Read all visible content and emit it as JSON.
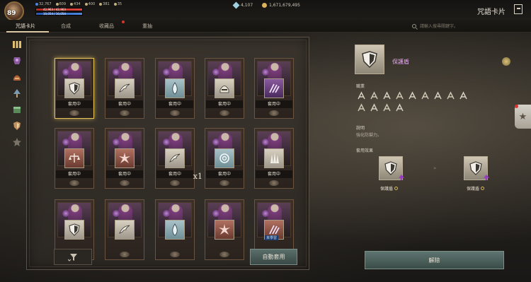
{
  "player": {
    "level": "89",
    "stats": [
      "32,767",
      "609",
      "434",
      "400",
      "381",
      "35"
    ],
    "hp_text": "42,963 / 42,963",
    "mp_text": "10,054 / 10,054"
  },
  "currency": {
    "gems": "4,107",
    "gold": "1,671,679,495"
  },
  "window": {
    "title": "咒語卡片"
  },
  "tabs": [
    {
      "label": "咒語卡片",
      "active": true
    },
    {
      "label": "合成",
      "active": false
    },
    {
      "label": "收藏品",
      "active": false,
      "badge": true
    },
    {
      "label": "重抽",
      "active": false
    }
  ],
  "search": {
    "placeholder": "請輸入搜尋關鍵字。"
  },
  "rail": [
    "all-cards-icon",
    "armor-icon",
    "helmet-icon",
    "tree-icon",
    "chest-icon",
    "shield-icon",
    "star-icon"
  ],
  "cards": [
    {
      "emblem": "shield",
      "tone": "light",
      "status": "套用中",
      "selected": true
    },
    {
      "emblem": "wing",
      "tone": "light",
      "status": "套用中"
    },
    {
      "emblem": "flame",
      "tone": "teal",
      "status": "套用中"
    },
    {
      "emblem": "helm",
      "tone": "light",
      "status": "套用中"
    },
    {
      "emblem": "claw",
      "tone": "purple",
      "status": "套用中"
    },
    {
      "emblem": "scale",
      "tone": "red",
      "status": "套用中"
    },
    {
      "emblem": "burst",
      "tone": "red",
      "status": "套用中"
    },
    {
      "emblem": "wing",
      "tone": "light",
      "status": "套用中",
      "count": "x1"
    },
    {
      "emblem": "swirl",
      "tone": "teal",
      "status": "套用中"
    },
    {
      "emblem": "spikes",
      "tone": "light",
      "status": "套用中"
    },
    {
      "emblem": "shield",
      "tone": "light",
      "status": ""
    },
    {
      "emblem": "wing",
      "tone": "light",
      "status": ""
    },
    {
      "emblem": "flame",
      "tone": "teal",
      "status": ""
    },
    {
      "emblem": "burst",
      "tone": "red",
      "status": ""
    },
    {
      "emblem": "claw",
      "tone": "red",
      "status": "",
      "tag": "未學習"
    }
  ],
  "buttons": {
    "auto_apply": "自動套用",
    "release": "解除"
  },
  "detail": {
    "name": "保護盾",
    "classes_label": "職業",
    "classes": [
      "warrior-icon",
      "archer-icon",
      "mage-icon",
      "knight-icon",
      "assassin-icon",
      "lancer-icon",
      "fencer-icon",
      "priest-icon",
      "dark-knight-icon",
      "gunner-icon",
      "monk-icon",
      "berserker-icon",
      "scythe-icon"
    ],
    "description_label": "說明",
    "description": "強化防禦力。",
    "set_effect_label": "套用效果",
    "set_from": "保護盾",
    "set_to": "保護盾"
  },
  "colors": {
    "accent": "#e6c45a",
    "name": "#e6a9f2",
    "button": "#4a5e5a"
  }
}
